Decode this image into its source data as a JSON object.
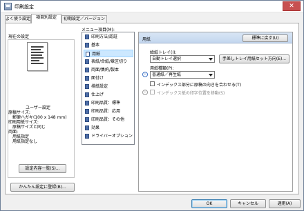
{
  "window": {
    "title": "印刷設定",
    "close": "✕"
  },
  "tabs": [
    {
      "label": "よく使う設定"
    },
    {
      "label": "項目別設定"
    },
    {
      "label": "初期設定／バージョン"
    }
  ],
  "left": {
    "current_settings_label": "現在の設定",
    "preset_name": "ユーザー設定",
    "details": [
      "原稿サイズ:",
      "　郵便ハガキ(100 x 148 mm)",
      "印刷用紙サイズ:",
      "　原稿サイズと同じ",
      "両面:",
      "　用紙指定",
      "　用紙指定なし"
    ],
    "list_button": "設定内容一覧(S)...",
    "register_button": "かんたん設定に登録(B)..."
  },
  "menu": {
    "label": "メニュー項目(M):",
    "items": [
      {
        "label": "印刷方法/認証",
        "icon": "print-method-icon"
      },
      {
        "label": "基本",
        "icon": "basic-icon"
      },
      {
        "label": "用紙",
        "icon": "paper-icon"
      },
      {
        "label": "表紙/合紙/章区切り",
        "icon": "cover-icon"
      },
      {
        "label": "両面/集約/製本",
        "icon": "duplex-icon"
      },
      {
        "label": "面付け",
        "icon": "imposition-icon"
      },
      {
        "label": "排紙設定",
        "icon": "output-icon"
      },
      {
        "label": "仕上げ",
        "icon": "finishing-icon"
      },
      {
        "label": "印刷品質：標準",
        "icon": "quality-standard-icon"
      },
      {
        "label": "印刷品質：応用",
        "icon": "quality-advanced-icon"
      },
      {
        "label": "印刷品質：その他",
        "icon": "quality-other-icon"
      },
      {
        "label": "効果",
        "icon": "effects-icon"
      },
      {
        "label": "ドライバーオプション",
        "icon": "driver-option-icon"
      }
    ],
    "selected_index": 2
  },
  "pane": {
    "title": "用紙",
    "reset_button": "標準に戻す(U)",
    "input_tray_label": "給紙トレイ(I):",
    "input_tray_value": "自動トレイ選択",
    "tray_setting_button": "手差しトレイ用紙セット方向(E)...",
    "paper_type_label": "用紙種類(P):",
    "paper_type_value": "普通紙／再生紙",
    "match_orientation_label": "インデックス部分に原稿の向きを合わせる(T)",
    "index_offset_label": "インデックス紙の印字位置を移動(S)"
  },
  "footer": {
    "ok": "OK",
    "cancel": "キャンセル",
    "apply": "適用(A)",
    "help": "ヘルプ"
  }
}
